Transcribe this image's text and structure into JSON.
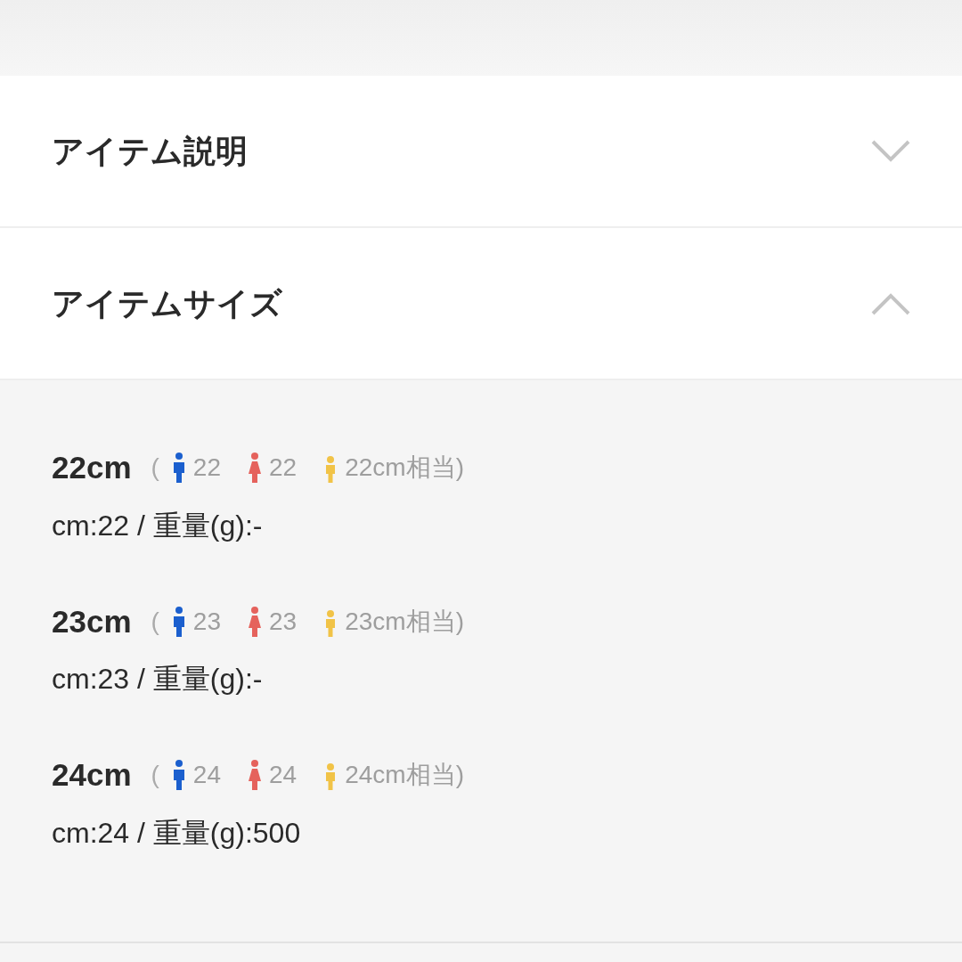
{
  "sections": [
    {
      "title": "アイテム説明",
      "expanded": false
    },
    {
      "title": "アイテムサイズ",
      "expanded": true
    }
  ],
  "sizes": [
    {
      "label": "22cm",
      "open": "(",
      "fits": [
        {
          "kind": "men",
          "text": "22"
        },
        {
          "kind": "women",
          "text": "22"
        },
        {
          "kind": "kids",
          "text": "22cm相当)"
        }
      ],
      "detail": "cm:22 / 重量(g):-"
    },
    {
      "label": "23cm",
      "open": "(",
      "fits": [
        {
          "kind": "men",
          "text": "23"
        },
        {
          "kind": "women",
          "text": "23"
        },
        {
          "kind": "kids",
          "text": "23cm相当)"
        }
      ],
      "detail": "cm:23 / 重量(g):-"
    },
    {
      "label": "24cm",
      "open": "(",
      "fits": [
        {
          "kind": "men",
          "text": "24"
        },
        {
          "kind": "women",
          "text": "24"
        },
        {
          "kind": "kids",
          "text": "24cm相当)"
        }
      ],
      "detail": "cm:24 / 重量(g):500"
    }
  ]
}
